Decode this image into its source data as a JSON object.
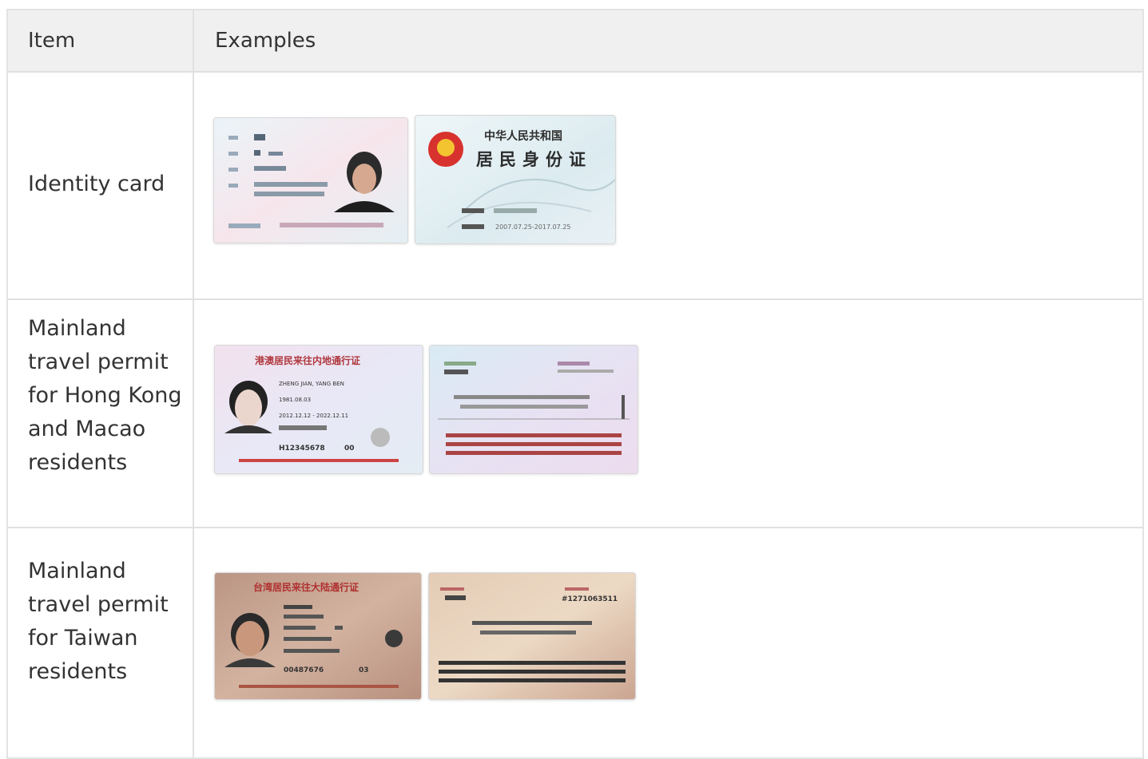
{
  "table": {
    "headers": {
      "item": "Item",
      "examples": "Examples"
    },
    "rows": [
      {
        "item": "Identity card",
        "examples": [
          {
            "name": "id-card-front",
            "label": ""
          },
          {
            "name": "id-card-back",
            "label": "中华人民共和国 居民身份证",
            "validity": "2007.07.25-2017.07.25"
          }
        ]
      },
      {
        "item": "Mainland travel permit for Hong Kong and Macao residents",
        "examples": [
          {
            "name": "hk-macao-permit-front",
            "label": "港澳居民来往内地通行证",
            "holder": "ZHENG JIAN, YANG BEN",
            "dob": "1981.08.03",
            "validity": "2012.12.12 - 2022.12.11",
            "number": "H12345678",
            "issue": "00"
          },
          {
            "name": "hk-macao-permit-back",
            "label": ""
          }
        ]
      },
      {
        "item": "Mainland travel permit for Taiwan residents",
        "examples": [
          {
            "name": "taiwan-permit-front",
            "label": "台湾居民来往大陆通行证",
            "number": "00487676",
            "issue": "03"
          },
          {
            "name": "taiwan-permit-back",
            "label": "",
            "number": "#1271063511"
          }
        ]
      }
    ]
  },
  "colors": {
    "header_bg": "#f0f0f0",
    "border": "#e0e0e0",
    "text": "#333333",
    "id_card": "#e6f1f4",
    "hk_card": "#eee3f1",
    "tw_card": "#c5a08c"
  }
}
